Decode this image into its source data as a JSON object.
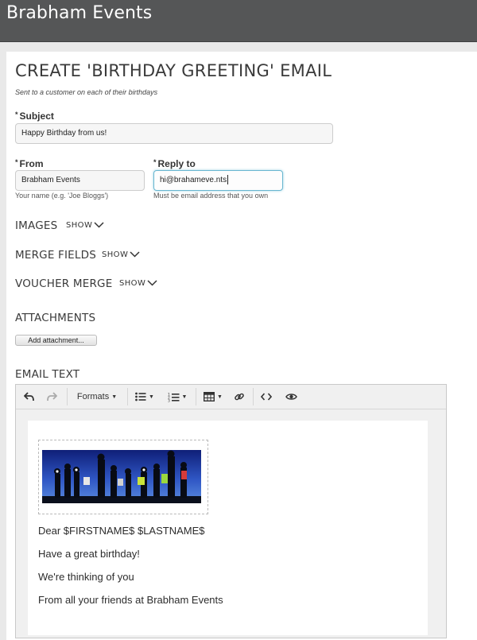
{
  "app": {
    "brand": "Brabham Events"
  },
  "page": {
    "title": "CREATE 'BIRTHDAY GREETING' EMAIL",
    "subtitle": "Sent to a customer on each of their birthdays"
  },
  "form": {
    "subject": {
      "label": "Subject",
      "value": "Happy Birthday from us!"
    },
    "from": {
      "label": "From",
      "value": "Brabham Events",
      "hint": "Your name (e.g. 'Joe Bloggs')"
    },
    "reply_to": {
      "label": "Reply to",
      "value": "hi@brahameve.nts",
      "hint": "Must be email address that you own"
    },
    "required_marker": "*"
  },
  "sections": {
    "images": {
      "title": "IMAGES",
      "toggle": "SHOW"
    },
    "merge_fields": {
      "title": "MERGE FIELDS",
      "toggle": "SHOW"
    },
    "voucher_merge": {
      "title": "VOUCHER MERGE",
      "toggle": "SHOW"
    },
    "attachments": {
      "title": "ATTACHMENTS",
      "button": "Add attachment..."
    },
    "email_text": {
      "title": "EMAIL TEXT"
    }
  },
  "editor": {
    "toolbar": {
      "undo_icon": "undo-icon",
      "redo_icon": "redo-icon",
      "formats_label": "Formats",
      "bullet_list_icon": "bullet-list-icon",
      "numbered_list_icon": "numbered-list-icon",
      "table_icon": "table-icon",
      "link_icon": "link-icon",
      "code_icon": "code-icon",
      "preview_icon": "eye-icon"
    },
    "body": {
      "image_alt": "group photo of runners at dusk",
      "lines": [
        "Dear $FIRSTNAME$ $LASTNAME$",
        "Have a great birthday!",
        "We're thinking of you",
        "From all your friends at Brabham Events"
      ]
    }
  },
  "colors": {
    "topbar": "#555657",
    "focus_border": "#68b6d0",
    "page_bg": "#e9e9e9"
  }
}
